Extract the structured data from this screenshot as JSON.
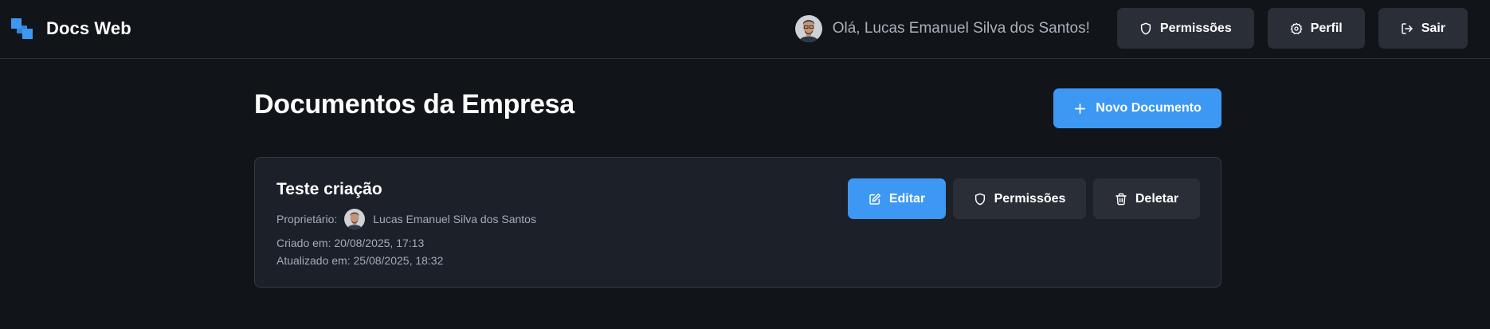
{
  "header": {
    "brand_name": "Docs Web",
    "greeting": "Olá, Lucas Emanuel Silva dos Santos!",
    "buttons": {
      "permissions": "Permissões",
      "profile": "Perfil",
      "logout": "Sair"
    }
  },
  "main": {
    "title": "Documentos da Empresa",
    "new_document_label": "Novo Documento"
  },
  "documents": [
    {
      "title": "Teste criação",
      "owner_label": "Proprietário:",
      "owner_name": "Lucas Emanuel Silva dos Santos",
      "created": "Criado em: 20/08/2025, 17:13",
      "updated": "Atualizado em: 25/08/2025, 18:32",
      "actions": {
        "edit": "Editar",
        "permissions": "Permissões",
        "delete": "Deletar"
      }
    }
  ],
  "colors": {
    "background": "#111418",
    "card": "#1c2028",
    "button_secondary": "#2a2f37",
    "accent": "#3d98f4"
  },
  "icons": {
    "brand": "docs-web-logo-icon",
    "permissions": "shield-icon",
    "profile": "gear-icon",
    "logout": "logout-icon",
    "new": "plus-icon",
    "edit": "edit-icon",
    "delete": "trash-icon"
  }
}
